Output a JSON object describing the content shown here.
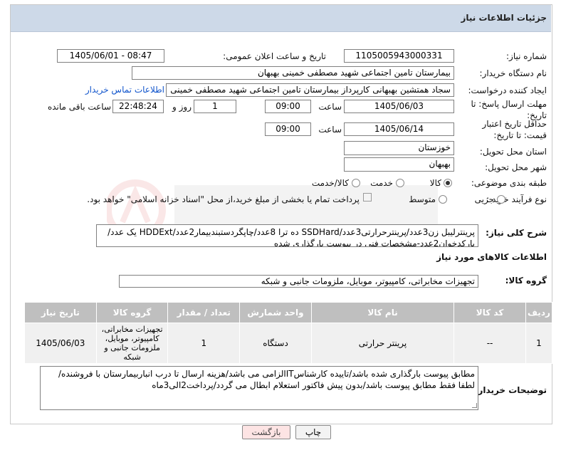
{
  "page_title": "جزئیات اطلاعات نیاز",
  "labels": {
    "need_number": "شماره نیاز:",
    "announce_datetime": "تاریخ و ساعت اعلان عمومی:",
    "buyer_org": "نام دستگاه خریدار:",
    "requester": "ایجاد کننده درخواست:",
    "reply_deadline": "مهلت ارسال پاسخ: تا تاریخ:",
    "price_validity": "حداقل تاریخ اعتبار قیمت: تا تاریخ:",
    "time_word": "ساعت",
    "day_and": "روز و",
    "remaining": "ساعت باقی مانده",
    "province": "استان محل تحویل:",
    "city": "شهر محل تحویل:",
    "category": "طبقه بندی موضوعی:",
    "purchase_type": "نوع فرآیند خرید :",
    "general_desc": "شرح کلی نیاز:",
    "goods_info": "اطلاعات کالاهای مورد نیاز",
    "goods_group": "گروه کالا:",
    "buyer_notes": "توضیحات خریدار:"
  },
  "values": {
    "need_number": "1105005943000331",
    "announce_datetime": "1405/06/01 - 08:47",
    "buyer_org": "بیمارستان تامین اجتماعی شهید مصطفی خمینی بهبهان",
    "requester": "سجاد همتشین بهبهانی کارپرداز بیمارستان تامین اجتماعی شهید مصطفی خمینی",
    "contact_link": "اطلاعات تماس خریدار",
    "reply_date": "1405/06/03",
    "reply_time": "09:00",
    "days": "1",
    "remaining_time": "22:48:24",
    "validity_date": "1405/06/14",
    "validity_time": "09:00",
    "province": "خوزستان",
    "city": "بهبهان",
    "goods_group": "تجهیزات مخابراتی، کامپیوتر، موبایل، ملزومات جانبی و شبکه",
    "general_desc": "پرینترلیبل زن3عدد/پرینترحرارتی3عدد/SSDHard ده ترا 8عدد/چاپگردستبندبیمار2عدد/HDDExt یک عدد/بارکدخوان2عدد-مشخصات فنی در پیوست بارگذاری شده",
    "buyer_notes": "مطابق پیوست بارگذاری شده باشد/تاییده کارشناسITالزامی می باشد/هزینه ارسال تا درب انباربیمارستان با فروشنده/لطفا فقط مطابق پیوست باشد/بدون پیش فاکتور استعلام ابطال می گردد/پرداخت2الی3ماه"
  },
  "category_options": [
    {
      "label": "کالا",
      "selected": true
    },
    {
      "label": "خدمت",
      "selected": false
    },
    {
      "label": "کالا/خدمت",
      "selected": false
    }
  ],
  "purchase_options": [
    {
      "label": "جزیی",
      "selected": false
    },
    {
      "label": "متوسط",
      "selected": false
    }
  ],
  "payment_note": "پرداخت تمام یا بخشی از مبلغ خرید،از محل \"اسناد خزانه اسلامی\" خواهد بود.",
  "table": {
    "headers": [
      "ردیف",
      "کد کالا",
      "نام کالا",
      "واحد شمارش",
      "تعداد / مقدار",
      "گروه کالا",
      "تاریخ نیاز"
    ],
    "rows": [
      [
        "1",
        "--",
        "پرینتر حرارتی",
        "دستگاه",
        "1",
        "تجهیزات مخابراتی، کامپیوتر، موبایل، ملزومات جانبی و شبکه",
        "1405/06/03"
      ]
    ]
  },
  "buttons": {
    "print": "چاپ",
    "back": "بازگشت"
  },
  "colors": {
    "header_bg": "#cdd9e8",
    "table_header_bg": "#bfbfbf",
    "link": "#1155cc",
    "back_button_bg": "#fde4e4"
  }
}
